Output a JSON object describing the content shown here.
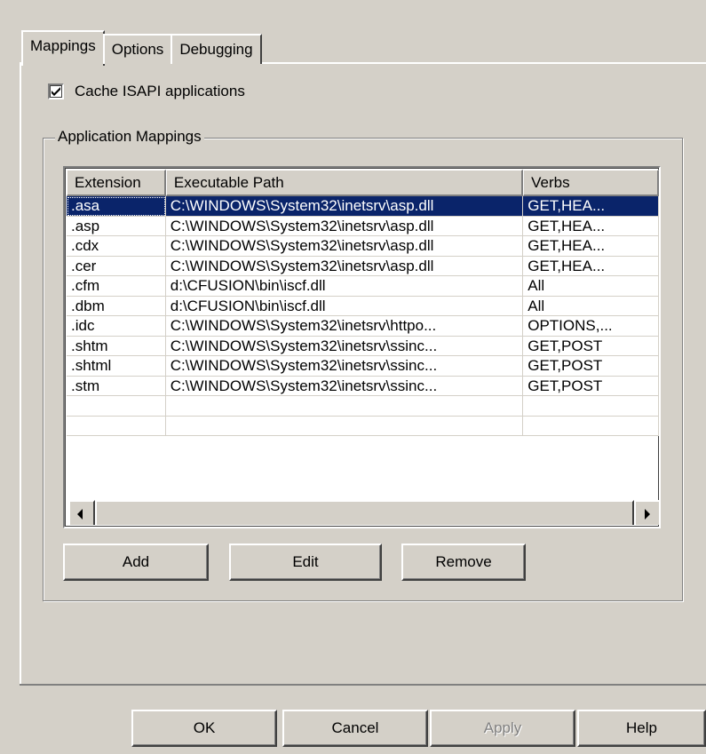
{
  "tabs": [
    {
      "label": "Mappings",
      "active": true
    },
    {
      "label": "Options",
      "active": false
    },
    {
      "label": "Debugging",
      "active": false
    }
  ],
  "cache_isapi": {
    "label": "Cache ISAPI applications",
    "checked": true
  },
  "group_title": "Application Mappings",
  "table": {
    "columns": [
      "Extension",
      "Executable Path",
      "Verbs"
    ],
    "rows": [
      {
        "ext": ".asa",
        "path": "C:\\WINDOWS\\System32\\inetsrv\\asp.dll",
        "verbs": "GET,HEA...",
        "selected": true
      },
      {
        "ext": ".asp",
        "path": "C:\\WINDOWS\\System32\\inetsrv\\asp.dll",
        "verbs": "GET,HEA..."
      },
      {
        "ext": ".cdx",
        "path": "C:\\WINDOWS\\System32\\inetsrv\\asp.dll",
        "verbs": "GET,HEA..."
      },
      {
        "ext": ".cer",
        "path": "C:\\WINDOWS\\System32\\inetsrv\\asp.dll",
        "verbs": "GET,HEA..."
      },
      {
        "ext": ".cfm",
        "path": "d:\\CFUSION\\bin\\iscf.dll",
        "verbs": "All"
      },
      {
        "ext": ".dbm",
        "path": "d:\\CFUSION\\bin\\iscf.dll",
        "verbs": "All"
      },
      {
        "ext": ".idc",
        "path": "C:\\WINDOWS\\System32\\inetsrv\\httpo...",
        "verbs": "OPTIONS,..."
      },
      {
        "ext": ".shtm",
        "path": "C:\\WINDOWS\\System32\\inetsrv\\ssinc...",
        "verbs": "GET,POST"
      },
      {
        "ext": ".shtml",
        "path": "C:\\WINDOWS\\System32\\inetsrv\\ssinc...",
        "verbs": "GET,POST"
      },
      {
        "ext": ".stm",
        "path": "C:\\WINDOWS\\System32\\inetsrv\\ssinc...",
        "verbs": "GET,POST"
      },
      {
        "ext": "",
        "path": "",
        "verbs": ""
      },
      {
        "ext": "",
        "path": "",
        "verbs": ""
      }
    ]
  },
  "mapping_buttons": {
    "add": "Add",
    "edit": "Edit",
    "remove": "Remove"
  },
  "dialog_buttons": {
    "ok": "OK",
    "cancel": "Cancel",
    "apply": "Apply",
    "help": "Help"
  }
}
